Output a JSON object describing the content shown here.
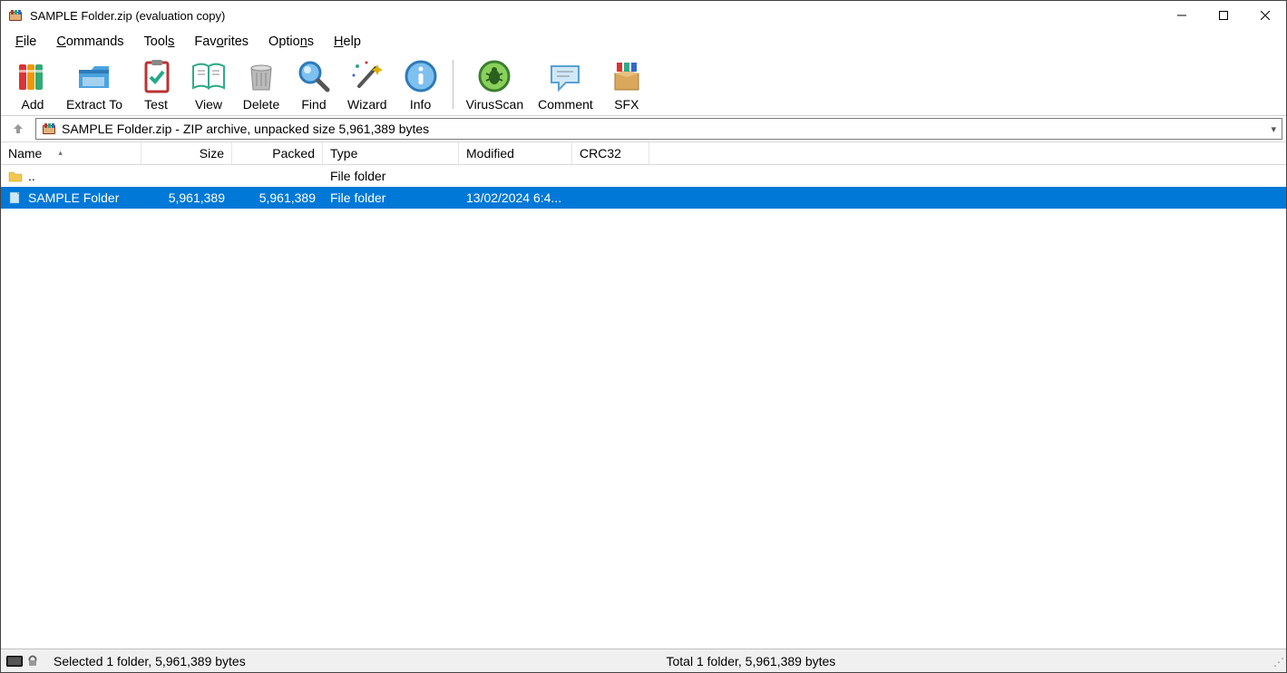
{
  "window": {
    "title": "SAMPLE Folder.zip (evaluation copy)"
  },
  "menu": {
    "file": "File",
    "commands": "Commands",
    "tools": "Tools",
    "favorites": "Favorites",
    "options": "Options",
    "help": "Help"
  },
  "toolbar": {
    "add": "Add",
    "extract": "Extract To",
    "test": "Test",
    "view": "View",
    "delete": "Delete",
    "find": "Find",
    "wizard": "Wizard",
    "info": "Info",
    "virusscan": "VirusScan",
    "comment": "Comment",
    "sfx": "SFX"
  },
  "pathbar": {
    "text": "SAMPLE Folder.zip - ZIP archive, unpacked size 5,961,389 bytes"
  },
  "columns": {
    "name": "Name",
    "size": "Size",
    "packed": "Packed",
    "type": "Type",
    "modified": "Modified",
    "crc32": "CRC32"
  },
  "rows": [
    {
      "name": "..",
      "size": "",
      "packed": "",
      "type": "File folder",
      "modified": "",
      "crc32": "",
      "icon": "folder-up",
      "selected": false
    },
    {
      "name": "SAMPLE Folder",
      "size": "5,961,389",
      "packed": "5,961,389",
      "type": "File folder",
      "modified": "13/02/2024 6:4...",
      "crc32": "",
      "icon": "folder-doc",
      "selected": true
    }
  ],
  "status": {
    "left": "Selected 1 folder, 5,961,389 bytes",
    "right": "Total 1 folder, 5,961,389 bytes"
  }
}
